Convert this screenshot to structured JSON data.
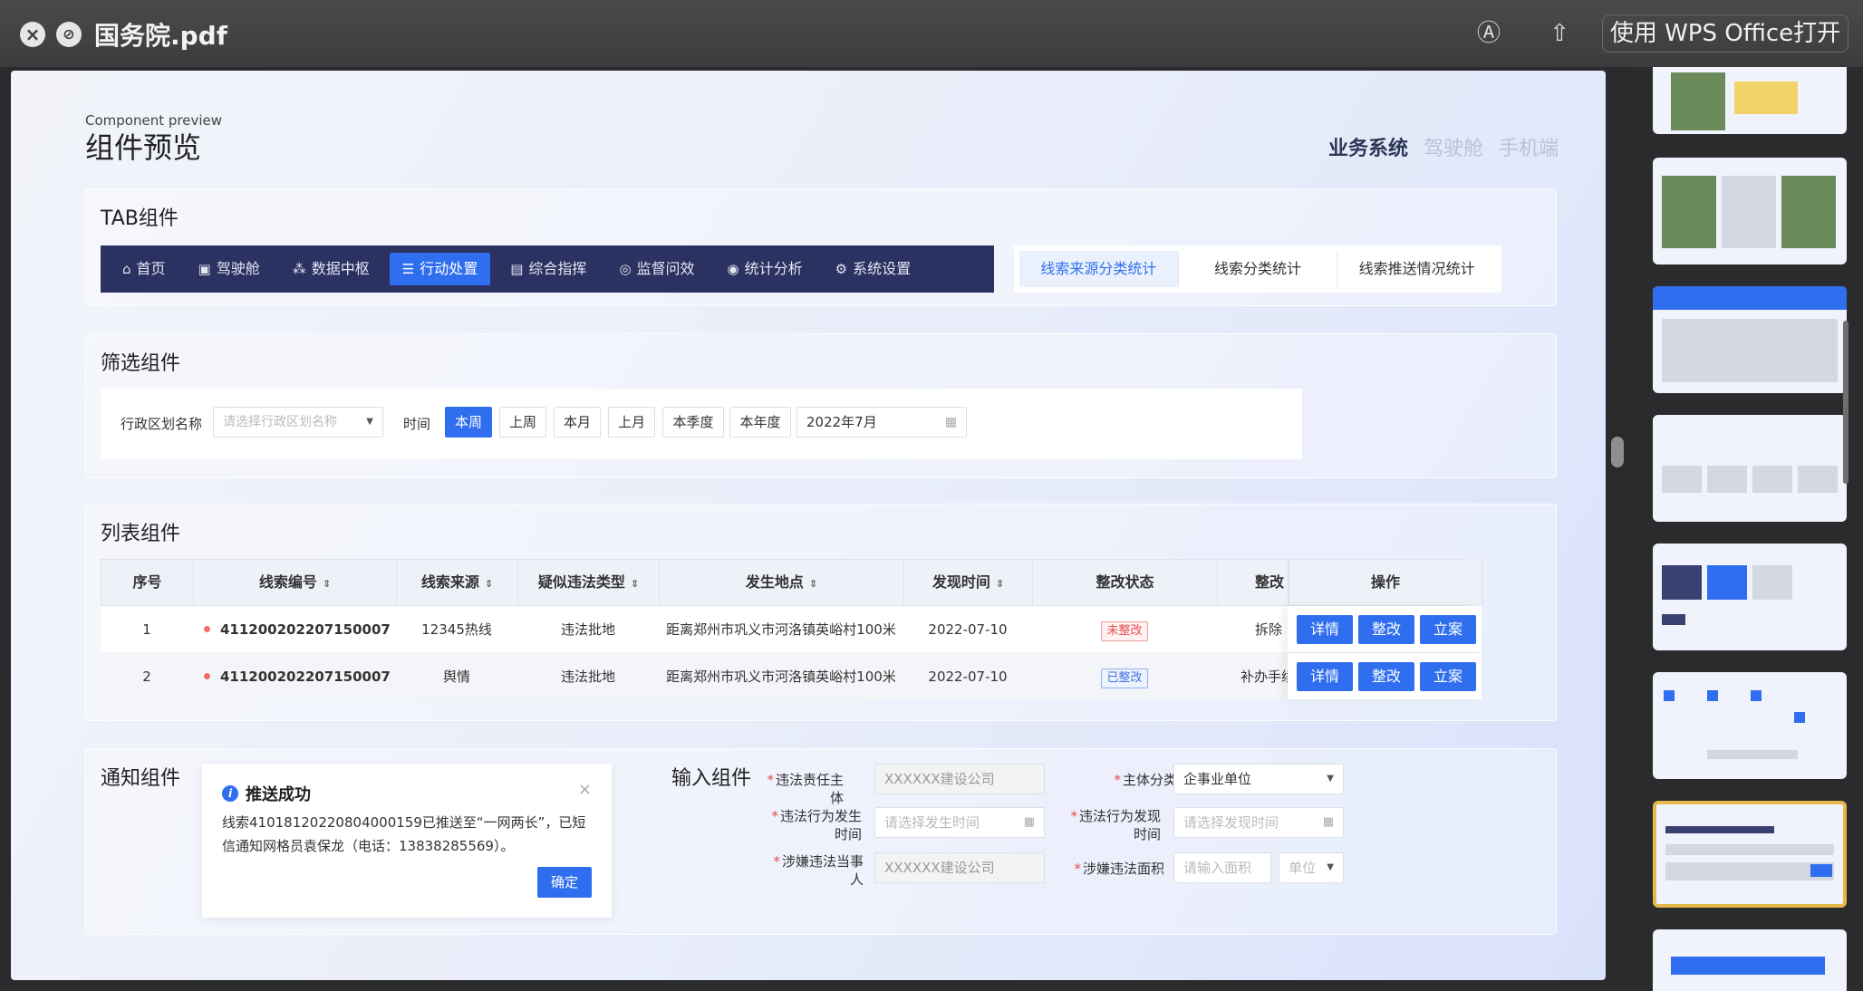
{
  "window": {
    "title": "国务院.pdf",
    "open_with": "使用 WPS Office打开"
  },
  "preview": {
    "en_title": "Component preview",
    "title": "组件预览",
    "systems": [
      "业务系统",
      "驾驶舱",
      "手机端"
    ]
  },
  "tab_section": {
    "title": "TAB组件",
    "nav": [
      {
        "label": "首页",
        "icon": "home-icon"
      },
      {
        "label": "驾驶舱",
        "icon": "dashboard-icon"
      },
      {
        "label": "数据中枢",
        "icon": "network-icon"
      },
      {
        "label": "行动处置",
        "icon": "list-icon"
      },
      {
        "label": "综合指挥",
        "icon": "command-icon"
      },
      {
        "label": "监督问效",
        "icon": "signal-icon"
      },
      {
        "label": "统计分析",
        "icon": "chart-icon"
      },
      {
        "label": "系统设置",
        "icon": "gear-icon"
      }
    ],
    "active_nav": "行动处置",
    "subtabs": [
      "线索来源分类统计",
      "线索分类统计",
      "线索推送情况统计"
    ]
  },
  "filter_section": {
    "title": "筛选组件",
    "region_label": "行政区划名称",
    "region_placeholder": "请选择行政区划名称",
    "time_label": "时间",
    "periods": [
      "本周",
      "上周",
      "本月",
      "上月",
      "本季度",
      "本年度"
    ],
    "active_period": "本周",
    "date_value": "2022年7月"
  },
  "list_section": {
    "title": "列表组件",
    "columns": [
      "序号",
      "线索编号",
      "线索来源",
      "疑似违法类型",
      "发生地点",
      "发现时间",
      "整改状态",
      "整改",
      "操作"
    ],
    "rows": [
      {
        "no": "1",
        "code": "411200202207150007",
        "source": "12345热线",
        "type": "违法批地",
        "place": "距离郑州市巩义市河洛镇英峪村100米",
        "time": "2022-07-10",
        "status": "未整改",
        "fix": "拆除"
      },
      {
        "no": "2",
        "code": "411200202207150007",
        "source": "舆情",
        "type": "违法批地",
        "place": "距离郑州市巩义市河洛镇英峪村100米",
        "time": "2022-07-10",
        "status": "已整改",
        "fix": "补办手续"
      }
    ],
    "actions": [
      "详情",
      "整改",
      "立案"
    ]
  },
  "notice_section": {
    "title": "通知组件",
    "notice_title": "推送成功",
    "notice_body": "线索41018120220804000159已推送至“一网两长”，已短信通知网格员袁保龙（电话：13838285569）。",
    "ok_label": "确定"
  },
  "input_section": {
    "title": "输入组件",
    "fields": [
      {
        "label": "违法责任主体",
        "value": "XXXXXX建设公司"
      },
      {
        "label": "主体分类",
        "value": "企事业单位"
      },
      {
        "label": "违法行为发生时间",
        "placeholder": "请选择发生时间"
      },
      {
        "label": "违法行为发现时间",
        "placeholder": "请选择发现时间"
      },
      {
        "label": "涉嫌违法当事人",
        "value": "XXXXXX建设公司"
      },
      {
        "label": "涉嫌违法面积",
        "placeholder": "请输入面积",
        "unit": "单位"
      }
    ]
  },
  "colors": {
    "accent": "#2f6fef",
    "nav_bg": "#2b3160",
    "thumb_selected": "#e4b84a"
  }
}
